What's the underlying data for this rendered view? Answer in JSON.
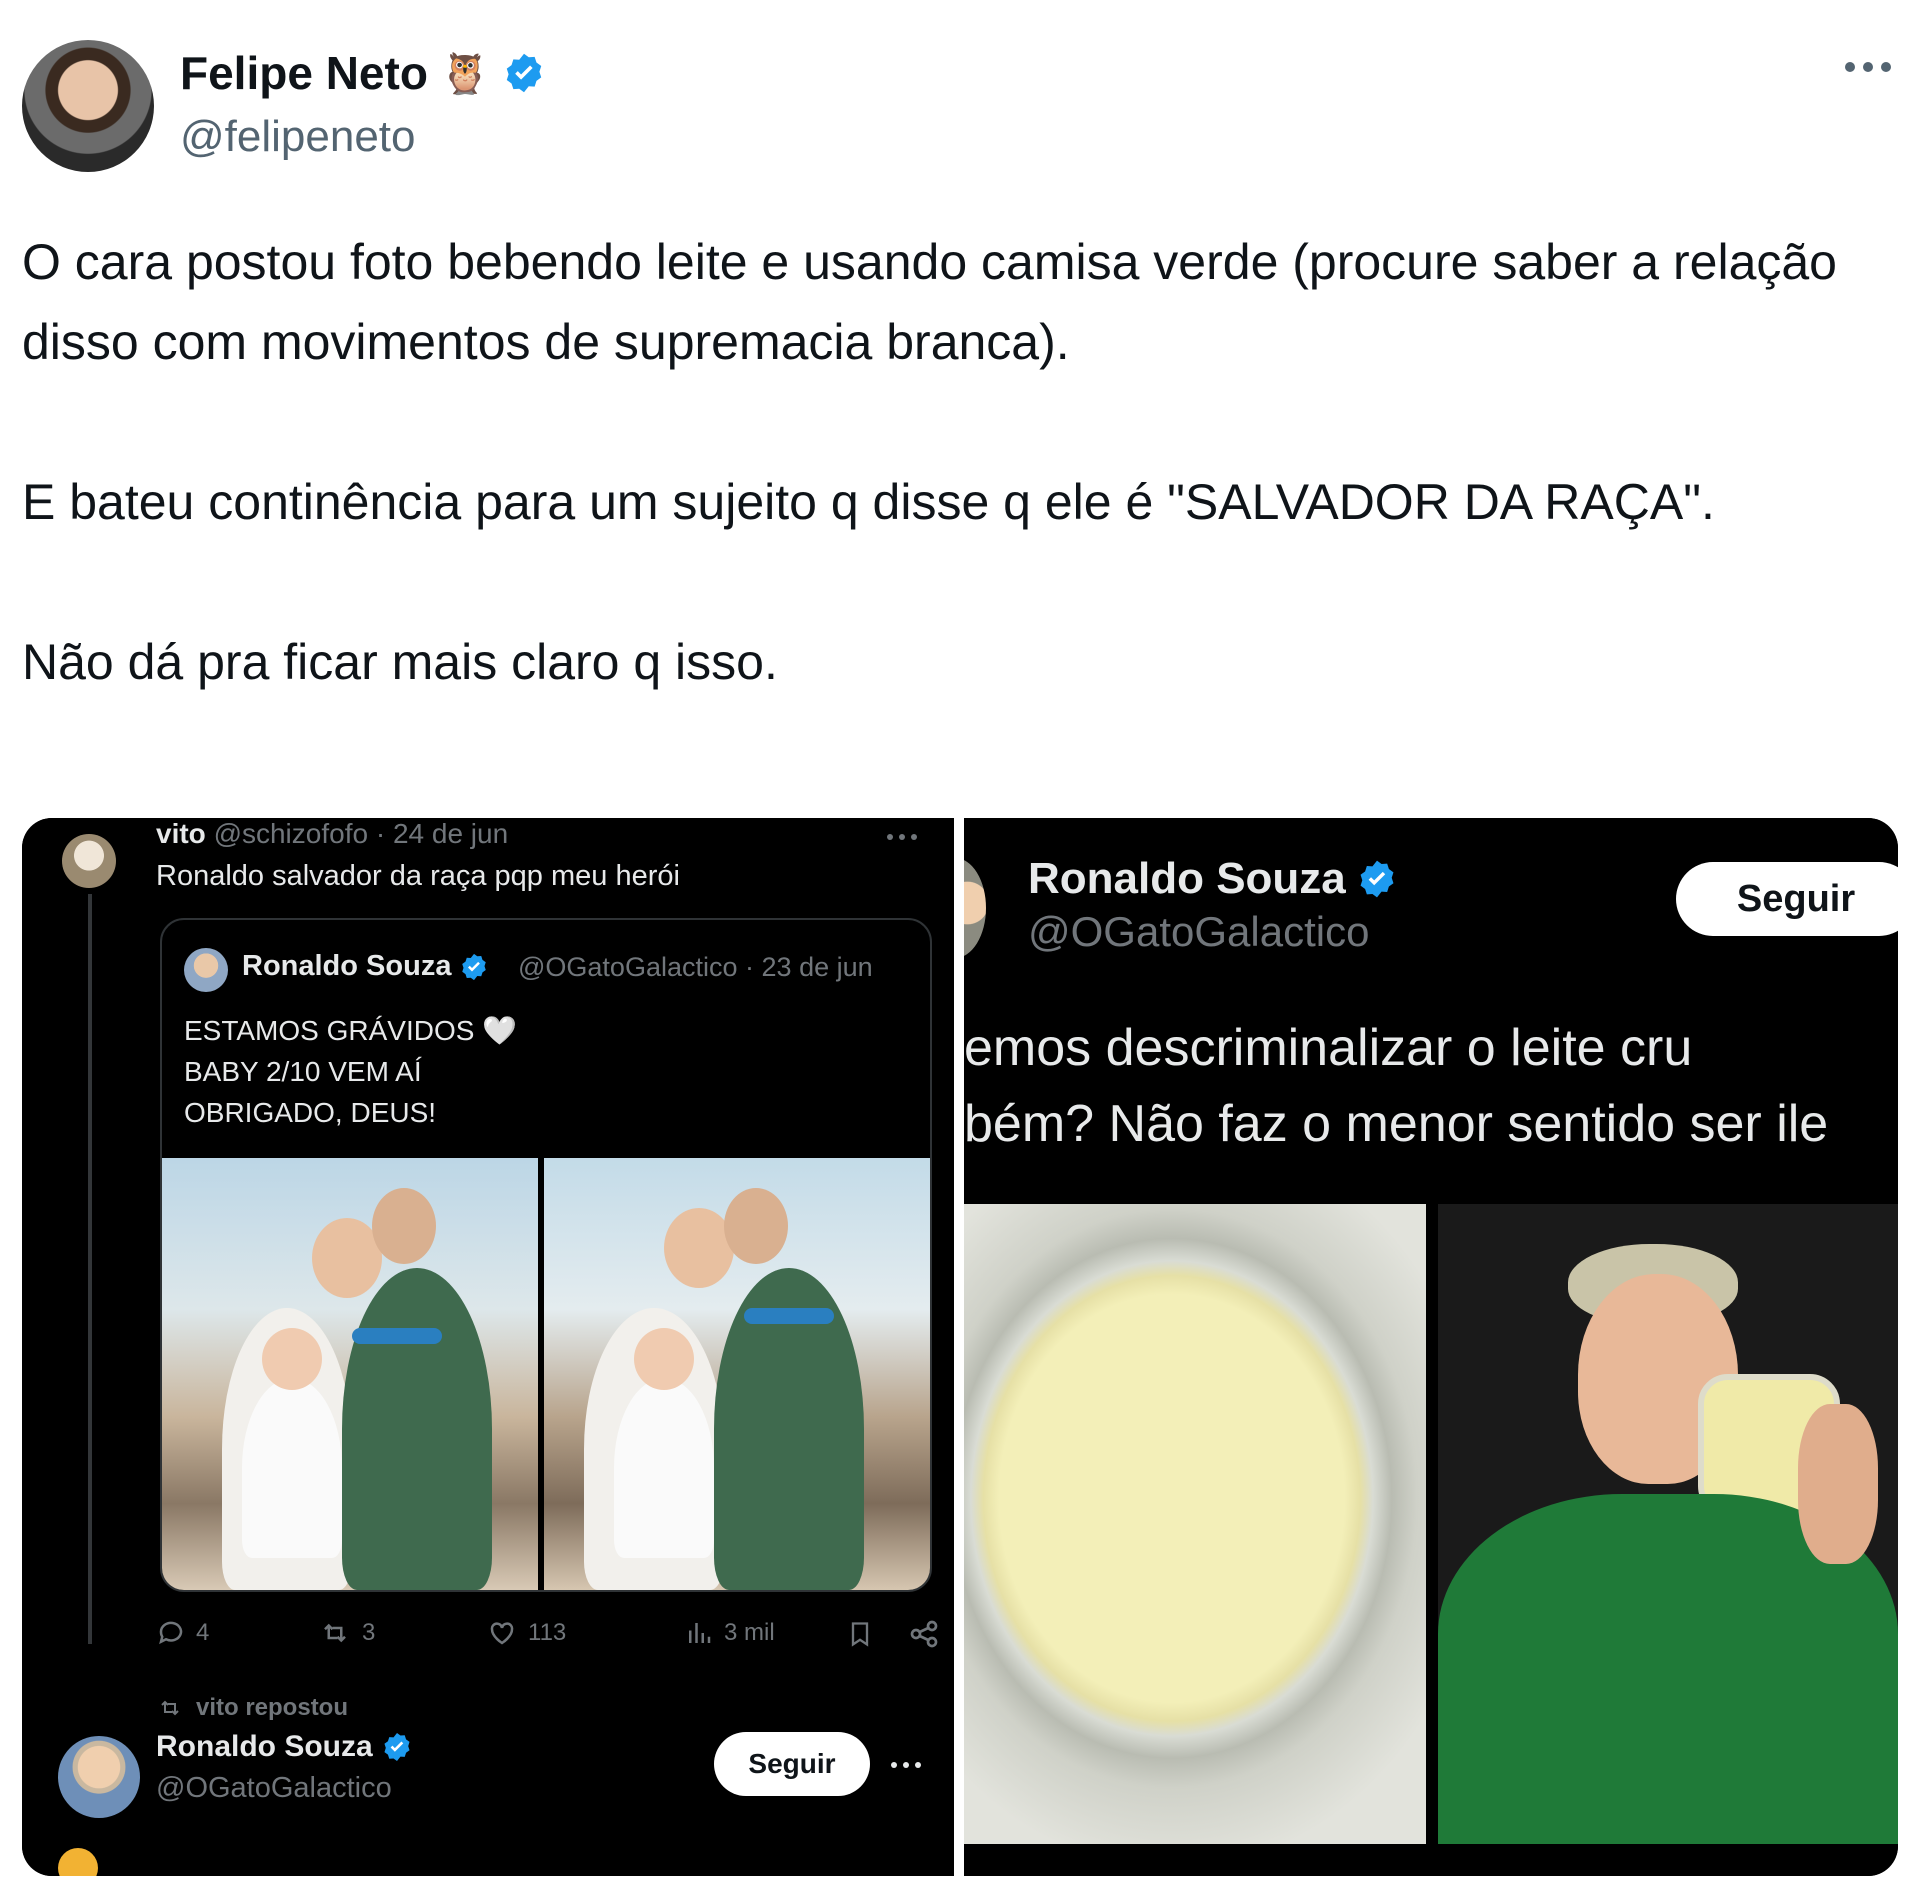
{
  "tweet": {
    "author_name": "Felipe Neto",
    "author_emoji": "🦉",
    "handle": "@felipeneto",
    "paragraphs": [
      "O cara postou foto bebendo leite e usando camisa verde (procure saber a relação disso com movimentos de supremacia branca).",
      "E bateu continência para um sujeito q disse q ele é \"SALVADOR DA RAÇA\".",
      "Não dá pra ficar mais claro q isso."
    ]
  },
  "left_screenshot": {
    "reply": {
      "name": "vito",
      "handle": "@schizofofo",
      "date": "24 de jun",
      "text": "Ronaldo salvador da raça pqp meu herói"
    },
    "quoted": {
      "name": "Ronaldo Souza",
      "handle": "@OGatoGalactico",
      "date": "23 de jun",
      "lines": [
        "ESTAMOS GRÁVIDOS 🤍",
        "BABY 2/10 VEM AÍ",
        "OBRIGADO, DEUS!"
      ]
    },
    "actions": {
      "replies": "4",
      "reposts": "3",
      "likes": "113",
      "views": "3 mil"
    },
    "repost_label": "vito repostou",
    "reposted_user": {
      "name": "Ronaldo Souza",
      "handle": "@OGatoGalactico",
      "follow_label": "Seguir"
    }
  },
  "right_screenshot": {
    "name": "Ronaldo Souza",
    "handle": "@OGatoGalactico",
    "follow_label": "Seguir",
    "text_lines": [
      "emos descriminalizar o leite cru",
      "bém? Não faz o menor sentido ser ile"
    ]
  },
  "colors": {
    "verified": "#1d9bf0",
    "text_primary": "#0f1419",
    "text_secondary": "#536471",
    "dark_bg": "#000000",
    "dark_text": "#e7e9ea",
    "dark_dim": "#71767b"
  }
}
